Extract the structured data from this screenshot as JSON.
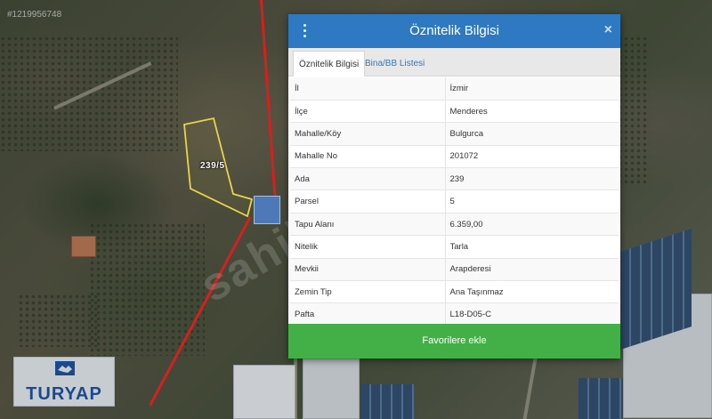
{
  "watermark": {
    "id": "#1219956748",
    "brand": "sahibinden"
  },
  "map": {
    "parcel_label": "239/5"
  },
  "logo": {
    "text": "TURYAP"
  },
  "dialog": {
    "title": "Öznitelik Bilgisi",
    "close_glyph": "×",
    "tabs": [
      {
        "label": "Öznitelik Bilgisi",
        "active": true
      },
      {
        "label": "Bina/BB Listesi",
        "active": false
      }
    ],
    "rows": [
      {
        "key": "İl",
        "value": "İzmir"
      },
      {
        "key": "İlçe",
        "value": "Menderes"
      },
      {
        "key": "Mahalle/Köy",
        "value": "Bulgurca"
      },
      {
        "key": "Mahalle No",
        "value": "201072"
      },
      {
        "key": "Ada",
        "value": "239"
      },
      {
        "key": "Parsel",
        "value": "5"
      },
      {
        "key": "Tapu Alanı",
        "value": "6.359,00"
      },
      {
        "key": "Nitelik",
        "value": "Tarla"
      },
      {
        "key": "Mevkii",
        "value": "Arapderesi"
      },
      {
        "key": "Zemin Tip",
        "value": "Ana Taşınmaz"
      },
      {
        "key": "Pafta",
        "value": "L18-D05-C"
      }
    ],
    "favorite_button": "Favorilere ekle"
  },
  "colors": {
    "header": "#2e79c1",
    "button": "#43b047",
    "parcel_outline": "#e8d44a",
    "road": "#d42020"
  },
  "icons": {
    "menu": "kebab-menu-icon",
    "close": "close-icon",
    "logo": "handshake-icon"
  }
}
